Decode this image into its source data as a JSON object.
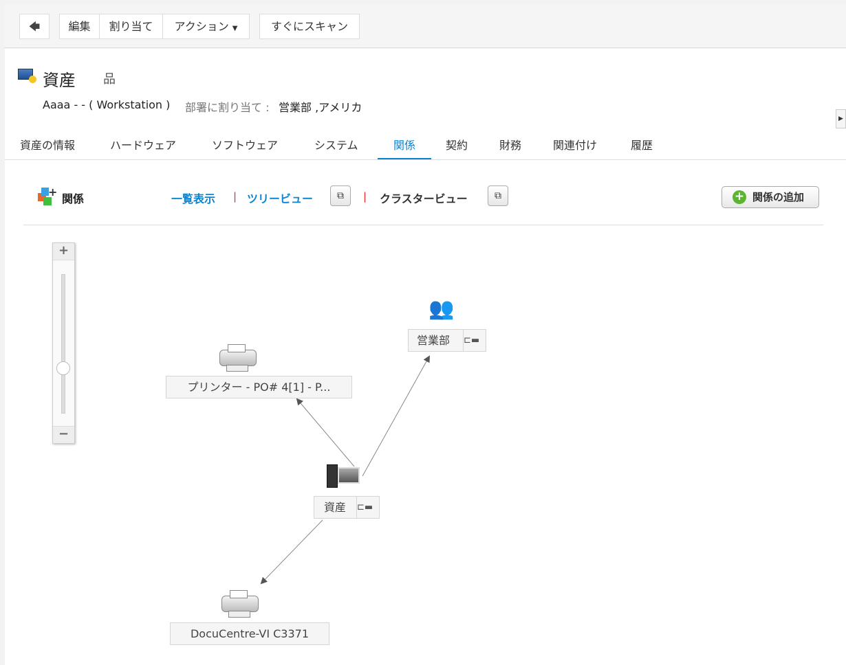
{
  "toolbar": {
    "back": "🡄",
    "edit": "編集",
    "assign": "割り当て",
    "actions": "アクション",
    "scan_now": "すぐにスキャン"
  },
  "header": {
    "title": "資産",
    "asset_name": "Aaaa - - ( Workstation )",
    "dept_label": "部署に割り当て :",
    "dept_value": "営業部 ,アメリカ"
  },
  "tabs": [
    "資産の情報",
    "ハードウェア",
    "ソフトウェア",
    "システム",
    "関係",
    "契約",
    "財務",
    "関連付け",
    "履歴"
  ],
  "relations": {
    "title": "関係",
    "list_view": "一覧表示",
    "tree_view": "ツリービュー",
    "cluster_view": "クラスタービュー",
    "add": "関係の追加"
  },
  "zoom": {
    "plus": "+",
    "minus": "−",
    "level": 0.4
  },
  "graph": {
    "nodes": {
      "printer1": "プリンター - PO# 4[1] - P...",
      "dept": "営業部",
      "asset": "資産",
      "printer2": "DocuCentre-VI C3371"
    }
  },
  "colors": {
    "accent": "#0a84d0"
  }
}
